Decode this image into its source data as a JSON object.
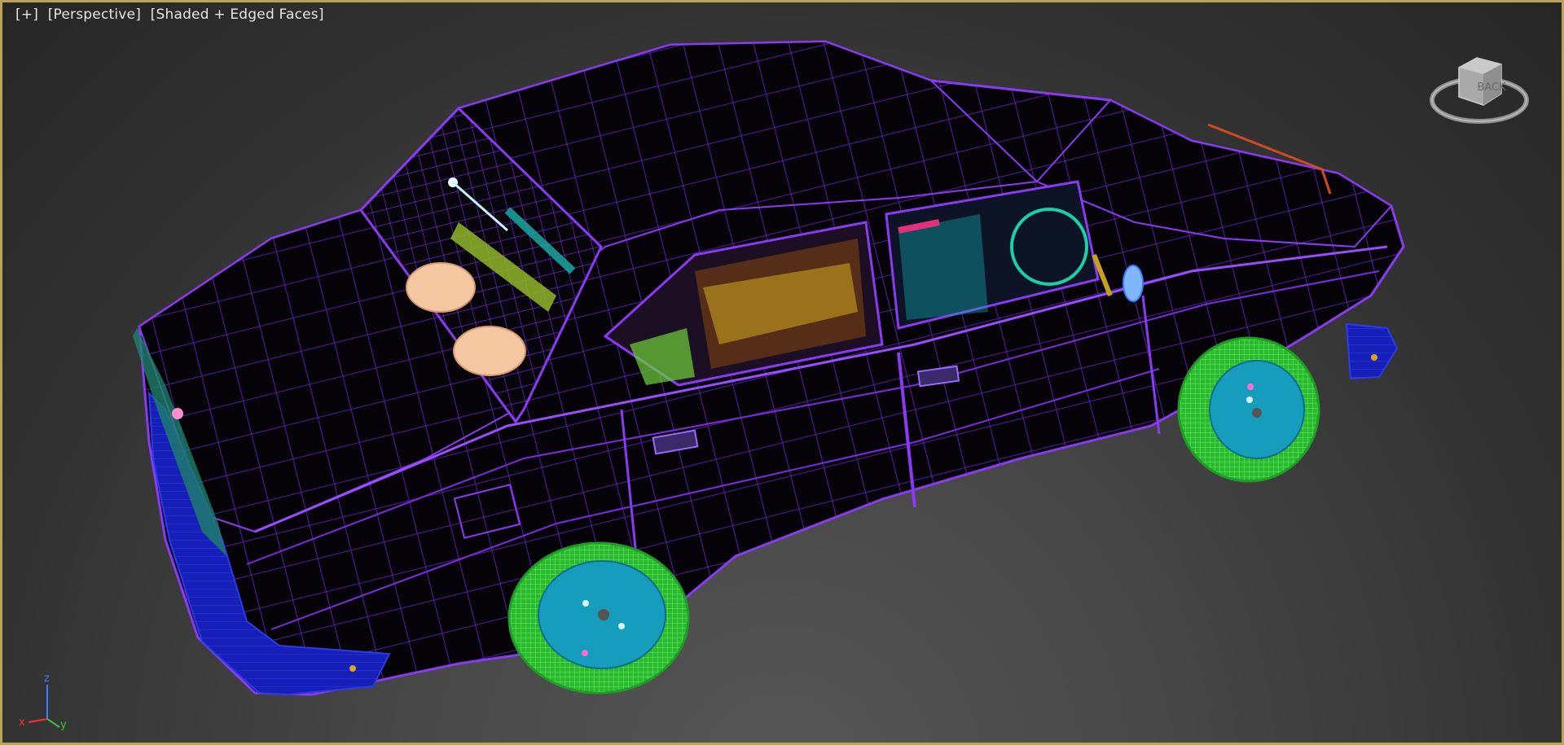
{
  "viewport": {
    "labels": {
      "plus": "[+]",
      "view": "[Perspective]",
      "shading": "[Shaded + Edged Faces]"
    }
  },
  "viewcube": {
    "face_label": "BACK"
  },
  "axis": {
    "z": "z",
    "x": "x",
    "y": "y"
  },
  "colors": {
    "wire": "#7b2be0",
    "wheel_tire": "#36d13b",
    "wheel_hub": "#1aa3c6",
    "bumper": "#1a22c9",
    "frame": "#b9a55a"
  },
  "icons": {
    "viewcube": "viewcube-icon",
    "axis": "axis-tripod-icon"
  }
}
